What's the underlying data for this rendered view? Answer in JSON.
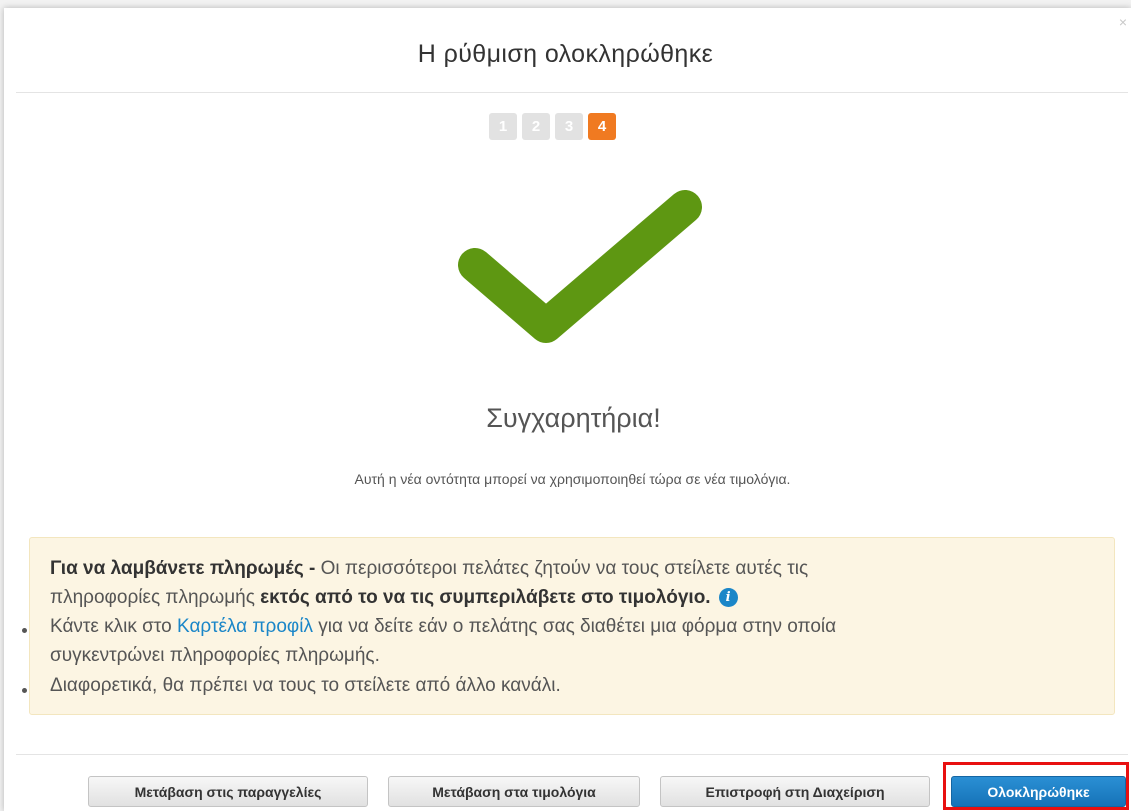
{
  "dialog": {
    "title": "Η ρύθμιση ολοκληρώθηκε",
    "close_icon": "×"
  },
  "stepper": {
    "steps": [
      "1",
      "2",
      "3",
      "4"
    ],
    "current_step": 4,
    "active_color": "#f07a21",
    "inactive_color": "#e2e2e2"
  },
  "success": {
    "icon": "check-icon",
    "icon_color": "#5e9712",
    "heading": "Συγχαρητήρια!",
    "message": "Αυτή η νέα οντότητα μπορεί να χρησιμοποιηθεί τώρα σε νέα τιμολόγια."
  },
  "notice": {
    "lead_bold": "Για να λαμβάνετε πληρωμές -",
    "lead_text": " Οι περισσότεροι πελάτες ζητούν να τους στείλετε αυτές τις",
    "line2_text": "πληροφορίες πληρωμής ",
    "line2_bold": "εκτός από το να τις συμπεριλάβετε στο τιμολόγιο.",
    "info_icon": "i",
    "bullet1_before": "Κάντε κλικ στο ",
    "bullet1_link": "Καρτέλα προφίλ",
    "bullet1_after": " για να δείτε εάν ο πελάτης σας διαθέτει μια φόρμα στην οποία",
    "bullet1_cont": "συγκεντρώνει πληροφορίες πληρωμής.",
    "bullet2": "Διαφορετικά, θα πρέπει να τους το στείλετε από άλλο κανάλι."
  },
  "footer": {
    "go_orders": "Μετάβαση στις παραγγελίες",
    "go_invoices": "Μετάβαση στα τιμολόγια",
    "back_admin": "Επιστροφή στη Διαχείριση",
    "done": "Ολοκληρώθηκε"
  },
  "colors": {
    "primary_button": "#1a7cc4",
    "highlight_border": "#e81010",
    "notice_bg": "#fcf5e3",
    "link": "#1a86c8"
  }
}
